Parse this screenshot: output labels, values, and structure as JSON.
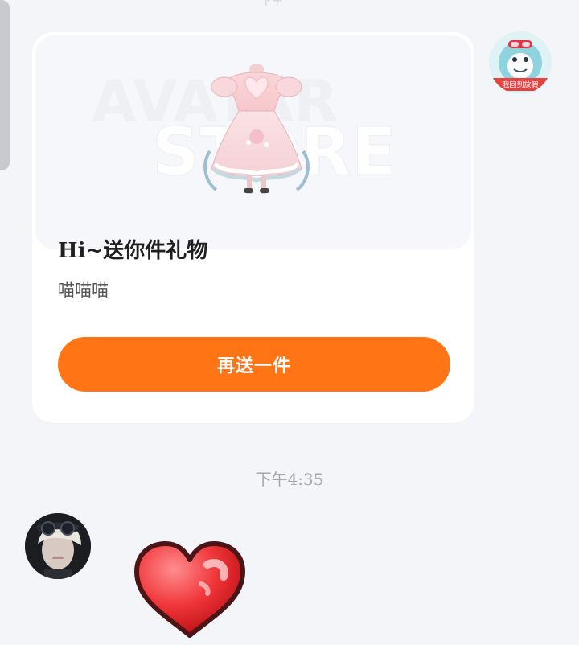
{
  "top_fragment": "下午",
  "gift_card": {
    "watermark_avatar": "AVATAR",
    "watermark_store": "STORE",
    "title": "Hi~送你件礼物",
    "subtitle": "喵喵喵",
    "resend_label": "再送一件",
    "accent_color": "#ff7415"
  },
  "right_avatar": {
    "caption": "我回到放假"
  },
  "timestamp": "下午4:35",
  "heart_sticker": {
    "color": "#e0262b"
  }
}
